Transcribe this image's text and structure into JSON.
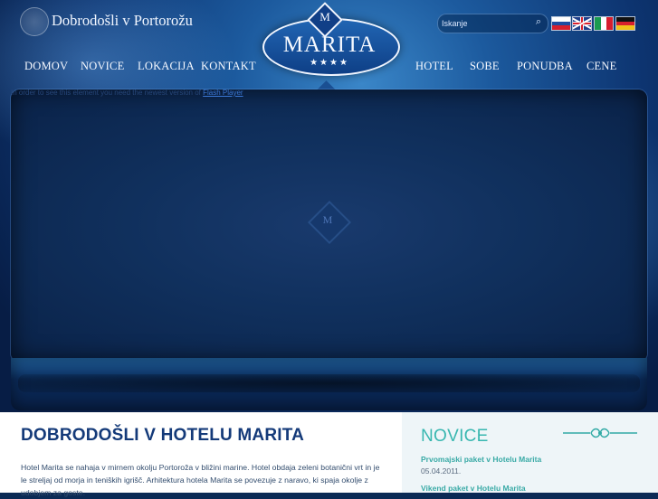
{
  "header": {
    "welcome_text": "Dobrodošli v Portorožu",
    "logo_name": "MARITA",
    "logo_stars": "★★★★",
    "logo_mark_glyph": "M",
    "search_placeholder": "Iskanje"
  },
  "nav": {
    "left": [
      {
        "label": "DOMOV"
      },
      {
        "label": "NOVICE"
      },
      {
        "label": "LOKACIJA"
      },
      {
        "label": "KONTAKT"
      }
    ],
    "right": [
      {
        "label": "HOTEL"
      },
      {
        "label": "SOBE"
      },
      {
        "label": "PONUDBA"
      },
      {
        "label": "CENE"
      }
    ]
  },
  "flash": {
    "note_prefix": "In order to see this element you need the newest version of ",
    "note_link": "Flash Player",
    "center_glyph": "M"
  },
  "main": {
    "title": "DOBRODOŠLI V HOTELU MARITA",
    "paragraph": "Hotel Marita se nahaja v mirnem okolju Portoroža v bližini marine. Hotel obdaja zeleni botanični vrt in je le streljaj od morja in teniških igrišč. Arhitektura hotela Marita se povezuje z naravo, ki spaja okolje z udobjem za goste."
  },
  "sidebar": {
    "title": "NOVICE",
    "news": [
      {
        "title": "Prvomajski paket v Hotelu Marita",
        "date": "05.04.2011."
      },
      {
        "title": "Vikend paket v Hotelu Marita",
        "date": ""
      }
    ]
  },
  "icons": {
    "search": "search-icon",
    "flag_si": "slovenia-flag-icon",
    "flag_gb": "uk-flag-icon",
    "flag_it": "italy-flag-icon",
    "flag_de": "germany-flag-icon",
    "ornament": "ornament-icon"
  },
  "colors": {
    "brand_blue": "#143a79",
    "accent_teal": "#38b7b0",
    "header_blue": "#1c5a9e"
  }
}
